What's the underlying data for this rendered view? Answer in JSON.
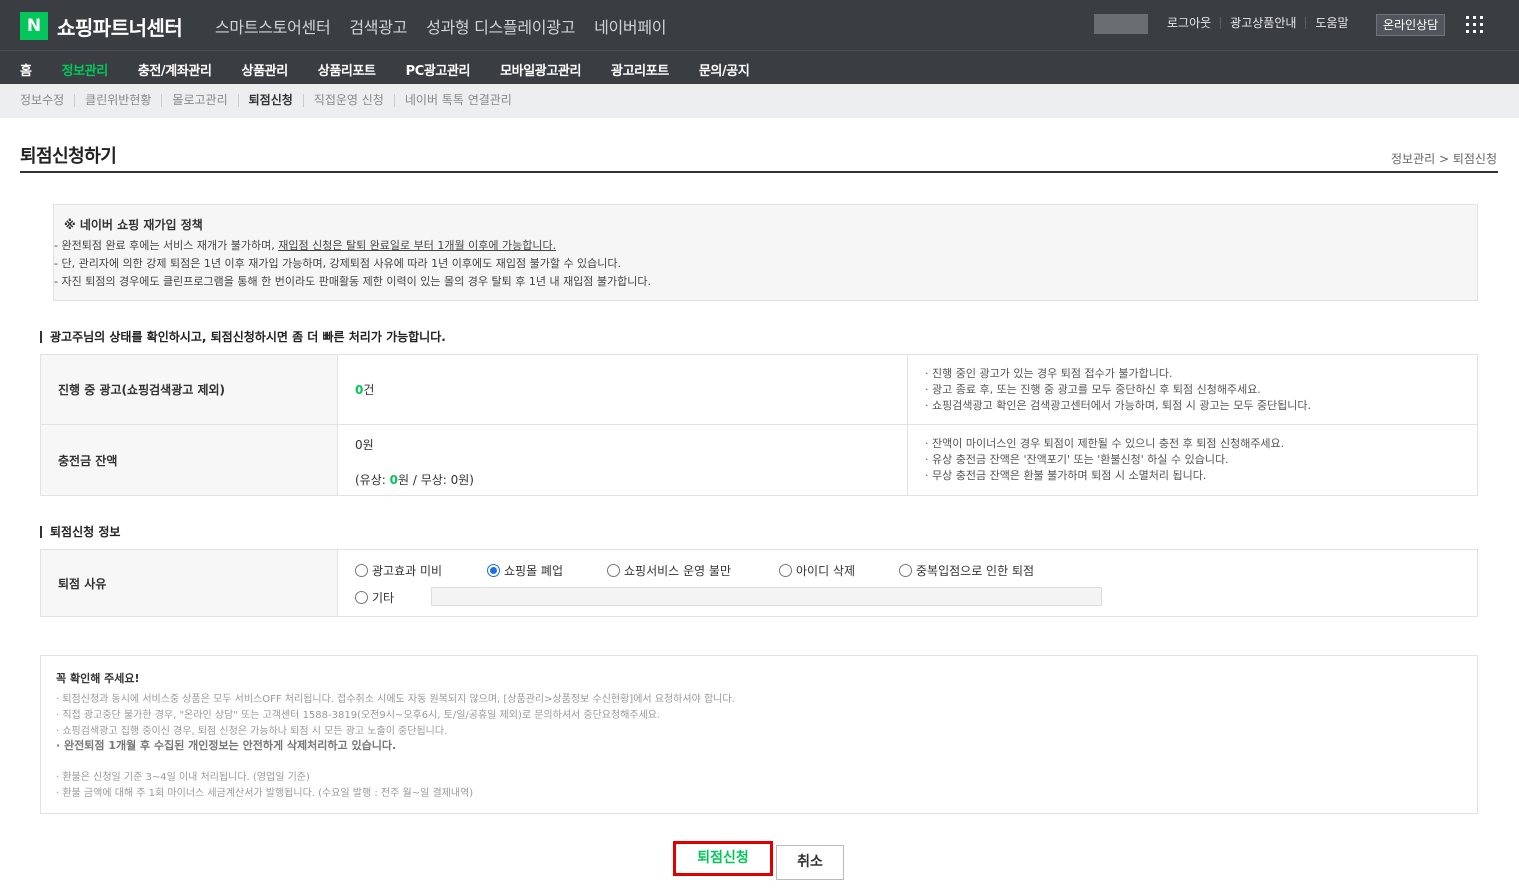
{
  "header": {
    "logo_letter": "N",
    "brand": "쇼핑파트너센터",
    "top_nav": [
      "스마트스토어센터",
      "검색광고",
      "성과형 디스플레이광고",
      "네이버페이"
    ],
    "util_links": [
      "로그아웃",
      "광고상품안내",
      "도움말"
    ],
    "counsel_label": "온라인상담",
    "accent_color": "#03c75a"
  },
  "main_nav": [
    "홈",
    "정보관리",
    "충전/계좌관리",
    "상품관리",
    "상품리포트",
    "PC광고관리",
    "모바일광고관리",
    "광고리포트",
    "문의/공지"
  ],
  "sub_nav": [
    "정보수정",
    "클린위반현황",
    "몰로고관리",
    "퇴점신청",
    "직접운영 신청",
    "네이버 톡톡 연결관리"
  ],
  "page": {
    "title": "퇴점신청하기",
    "breadcrumb": "정보관리 > 퇴점신청"
  },
  "policy": {
    "title": "※ 네이버 쇼핑 재가입 정책",
    "line1_prefix": "- 완전퇴점 완료 후에는 서비스 재개가 불가하며, ",
    "line1_underlined": "재입점 신청은 탈퇴 완료일로 부터 1개월 이후에 가능합니다.",
    "line2": "- 단, 관리자에 의한 강제 퇴점은 1년 이후 재가입 가능하며, 강제퇴점 사유에 따라 1년 이후에도 재입점 불가할 수 있습니다.",
    "line3": "- 자진 퇴점의 경우에도 클린프로그램을 통해 한 번이라도 판매활동 제한 이력이 있는 몰의 경우 탈퇴 후 1년 내 재입점 불가합니다."
  },
  "status_section": {
    "heading": "광고주님의 상태를 확인하시고, 퇴점신청하시면 좀 더 빠른 처리가 가능합니다.",
    "ad_row": {
      "label": "진행 중 광고(쇼핑검색광고 제외)",
      "count": "0",
      "unit": "건",
      "notes": [
        "· 진행 중인 광고가 있는 경우 퇴점 접수가 불가합니다.",
        "· 광고 종료 후, 또는 진행 중 광고를 모두 중단하신 후 퇴점 신청해주세요.",
        "· 쇼핑검색광고 확인은 검색광고센터에서 가능하며, 퇴점 시 광고는 모두 중단됩니다."
      ]
    },
    "balance_row": {
      "label": "충전금 잔액",
      "total": "0원",
      "paid_prefix": "(유상: ",
      "paid_value": "0",
      "paid_suffix": "원 / 무상: 0원)",
      "notes": [
        "· 잔액이 마이너스인 경우 퇴점이 제한될 수 있으니 충전 후 퇴점 신청해주세요.",
        "· 유상 충전금 잔액은 '잔액포기' 또는 '환불신청' 하실 수 있습니다.",
        "· 무상 충전금 잔액은 환불 불가하며 퇴점 시 소멸처리 됩니다."
      ]
    }
  },
  "withdraw_section": {
    "heading": "퇴점신청 정보",
    "reason_label": "퇴점 사유",
    "reasons": [
      "광고효과 미비",
      "쇼핑몰 폐업",
      "쇼핑서비스 운영 불만",
      "아이디 삭제",
      "중복입점으로 인한 퇴점"
    ],
    "selected_reason": "쇼핑몰 폐업",
    "other_label": "기타",
    "other_value": ""
  },
  "notice": {
    "title": "꼭 확인해 주세요!",
    "lines": [
      "· 퇴점신청과 동시에 서비스중 상품은 모두 서비스OFF 처리됩니다. 접수취소 시에도 자동 원복되지 않으며, [상품관리>상품정보 수신현황]에서 요청하셔야 합니다.",
      "· 직접 광고중단 불가한 경우, \"온라인 상담\" 또는 고객센터 1588-3819(오전9시~오후6시, 토/일/공휴일 제외)로 문의하셔서 중단요청해주세요.",
      "· 쇼핑검색광고 집행 중이신 경우, 퇴점 신청은 가능하나 퇴점 시 모든 광고 노출이 중단됩니다.",
      "· 완전퇴점 1개월 후 수집된 개인정보는 안전하게 삭제처리하고 있습니다.",
      "· 환불은 신청일 기준 3~4일 이내 처리됩니다. (영업일 기준)",
      "· 환불 금액에 대해 주 1회 마이너스 세금계산서가 발행됩니다. (수요일 발행 : 전주 월~일 결제내역)"
    ]
  },
  "buttons": {
    "submit": "퇴점신청",
    "cancel": "취소",
    "highlight_color": "#e00000"
  }
}
